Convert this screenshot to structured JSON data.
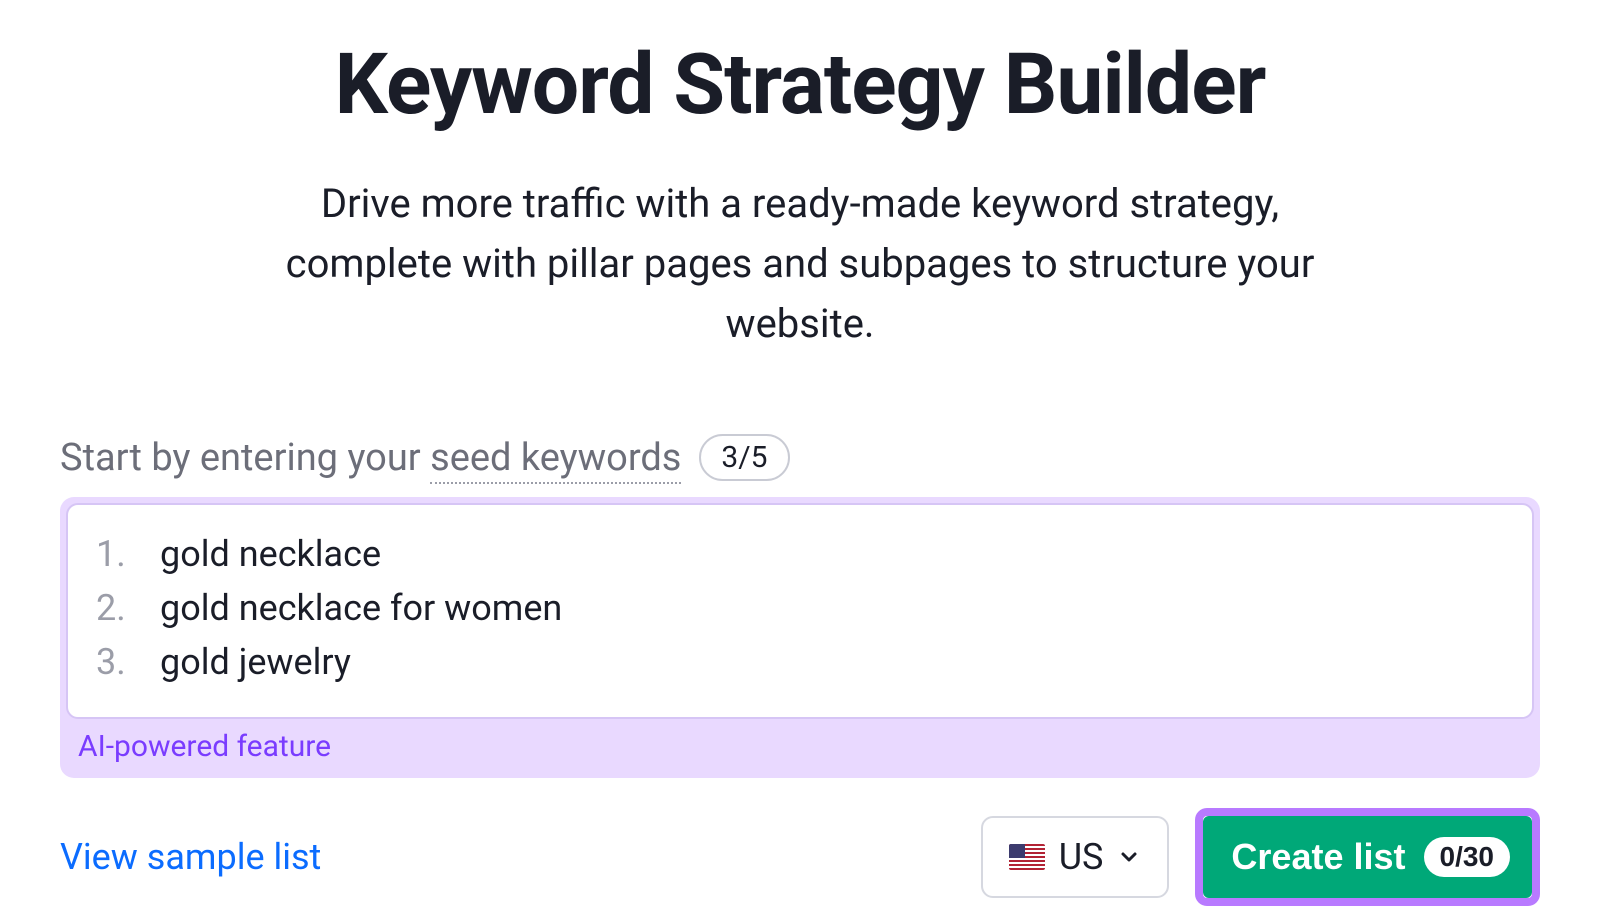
{
  "header": {
    "title": "Keyword Strategy Builder",
    "subtitle": "Drive more traffic with a ready-made keyword strategy, complete with pillar pages and subpages to structure your website."
  },
  "seed": {
    "label_prefix": "Start by entering your ",
    "label_underline": "seed keywords",
    "counter": "3/5"
  },
  "keywords": [
    "gold necklace",
    "gold necklace for women",
    "gold jewelry"
  ],
  "ai_tag": "AI-powered feature",
  "footer": {
    "view_sample_label": "View sample list",
    "country": {
      "code": "US",
      "icon_name": "flag-us-icon"
    },
    "create_button": {
      "label": "Create list",
      "count": "0/30"
    }
  },
  "colors": {
    "accent_purple": "#b87aff",
    "accent_purple_light": "#e9d9ff",
    "button_green": "#00a878",
    "link_blue": "#0b6cff",
    "text_dark": "#1a1d28",
    "text_muted": "#6c6e79"
  }
}
